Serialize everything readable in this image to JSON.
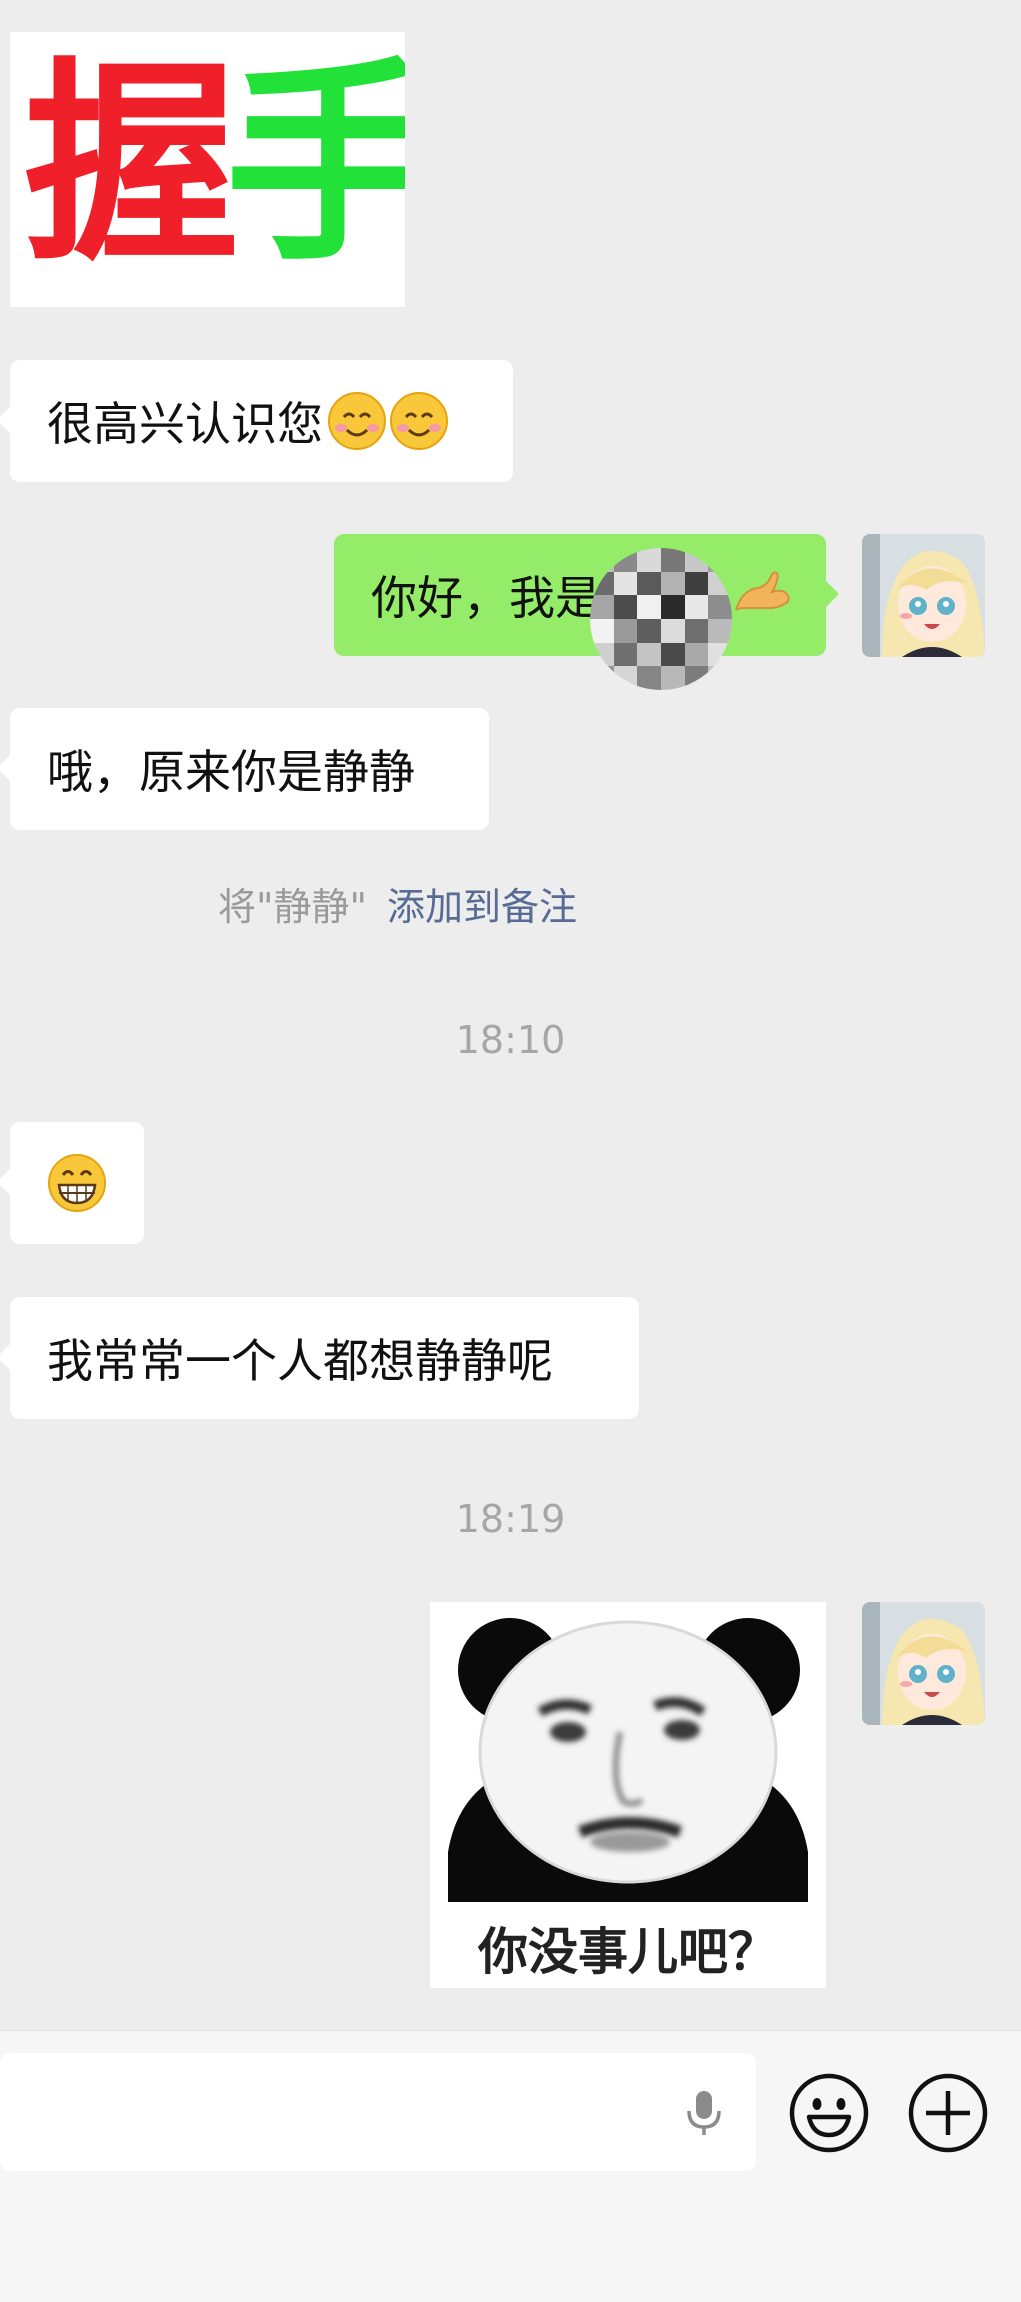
{
  "messages": {
    "sticker_handshake": {
      "char1": "握",
      "char2": "手"
    },
    "m1": "很高兴认识您",
    "m2_visible": "你好，我是",
    "m3": "哦，原来你是静静",
    "remark_prefix": "将\"静静\"",
    "remark_link": "添加到备注",
    "time1": "18:10",
    "m4_emoji": "grinning-face",
    "m5": "我常常一个人都想静静呢",
    "time2": "18:19",
    "sticker_panda_caption": "你没事儿吧？"
  },
  "input": {
    "value": ""
  },
  "icons": {
    "voice": "microphone-icon",
    "emoji": "smiley-icon",
    "more": "plus-circle-icon"
  },
  "colors": {
    "background": "#ededed",
    "incoming_bubble": "#ffffff",
    "outgoing_bubble": "#95ec69",
    "link": "#576b95",
    "handshake_red": "#f0202a",
    "handshake_green": "#22e23a"
  }
}
